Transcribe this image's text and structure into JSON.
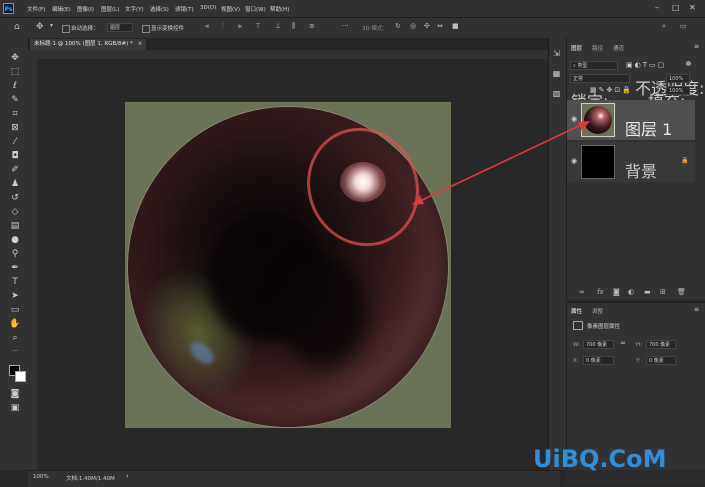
{
  "app": {
    "logo": "Ps"
  },
  "menu": [
    "文件(F)",
    "编辑(E)",
    "图像(I)",
    "图层(L)",
    "文字(Y)",
    "选择(S)",
    "滤镜(T)",
    "3D(D)",
    "视图(V)",
    "窗口(W)",
    "帮助(H)"
  ],
  "options": {
    "auto_select": "自动选择：",
    "layer_select": "图层",
    "show_transform": "显示变换控件",
    "mode3d": "3D 模式："
  },
  "document": {
    "tab_title": "未标题-1 @ 100% (图层 1, RGB/8#) *"
  },
  "status": {
    "zoom": "100%",
    "doc": "文档:1.40M/1.40M"
  },
  "layers_panel": {
    "tabs": [
      "图层",
      "路径",
      "通道"
    ],
    "filter_kind": "类型",
    "blend_mode": "正常",
    "opacity_label": "不透明度:",
    "opacity_value": "100%",
    "lock_label": "锁定:",
    "fill_label": "填充:",
    "fill_value": "100%",
    "layers": [
      {
        "name": "图层 1"
      },
      {
        "name": "背景"
      }
    ]
  },
  "properties_panel": {
    "tabs": [
      "属性",
      "调整"
    ],
    "title": "像素图层属性",
    "w_label": "W:",
    "w_value": "700 像素",
    "h_label": "H:",
    "h_value": "700 像素",
    "x_label": "X:",
    "x_value": "0 像素",
    "y_label": "Y:",
    "y_value": "0 像素"
  },
  "watermark": "UiBQ.CoM",
  "colors": {
    "accent_arrow": "#e0393a",
    "watermark": "#2f8fd8",
    "canvas_bg": "#6b7356"
  }
}
